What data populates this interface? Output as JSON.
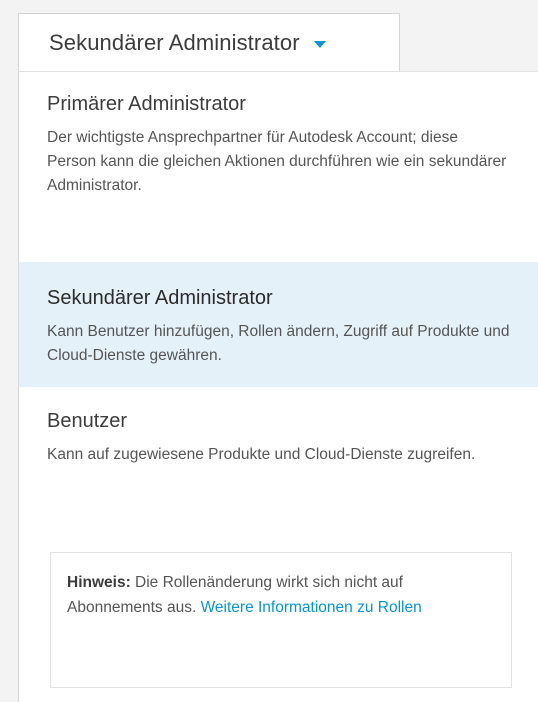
{
  "dropdown": {
    "selected": "Sekundärer Administrator",
    "caret_icon": "caret-down-icon",
    "accent": "#0696d7"
  },
  "options": [
    {
      "title": "Primärer Administrator",
      "description": "Der wichtigste Ansprechpartner für Autodesk Account; diese Person kann die gleichen Aktionen durchführen wie ein sekundärer Administrator."
    },
    {
      "title": "Sekundärer Administrator",
      "description": "Kann Benutzer hinzufügen, Rollen ändern, Zugriff auf Produkte und Cloud-Dienste gewähren.",
      "selected": true,
      "highlight_color": "#e5f1f9"
    },
    {
      "title": "Benutzer",
      "description": "Kann auf zugewiesene Produkte und Cloud-Dienste zugreifen."
    }
  ],
  "note": {
    "label": "Hinweis:",
    "text": " Die Rollenänderung wirkt sich nicht auf Abonnements aus. ",
    "link": "Weitere Informationen zu Rollen"
  }
}
